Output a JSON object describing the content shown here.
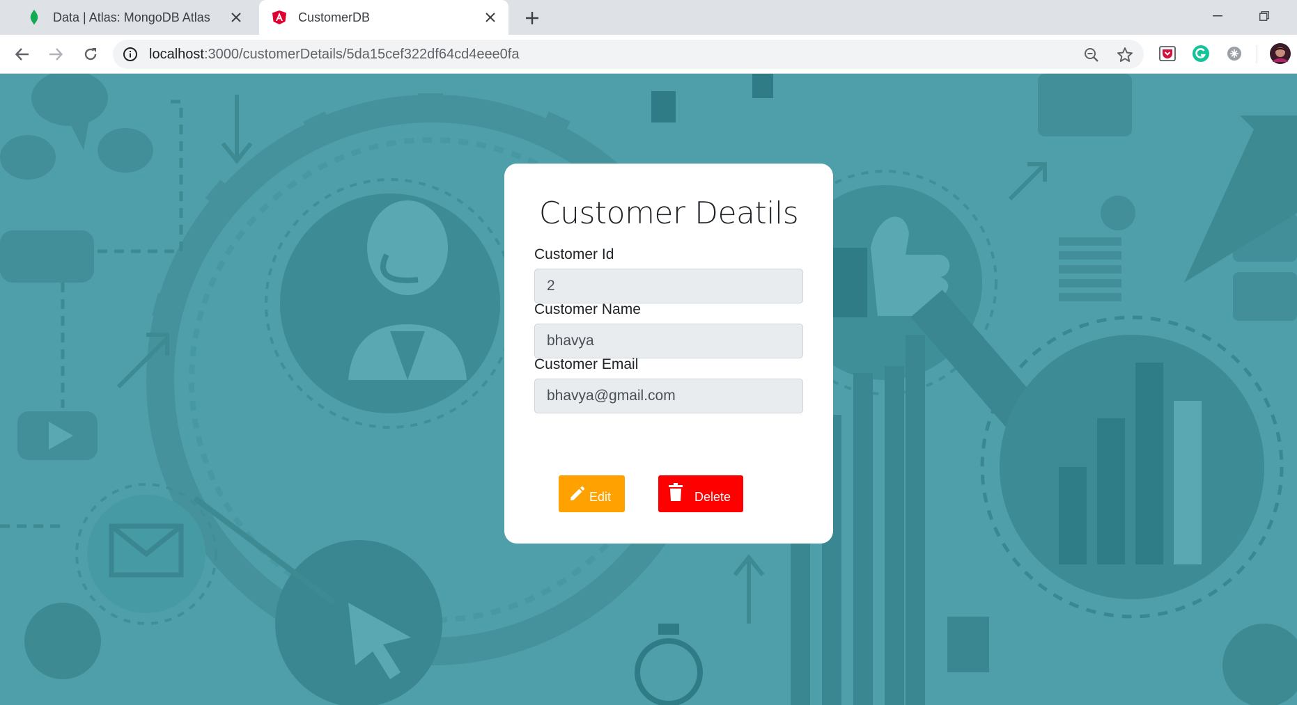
{
  "browser": {
    "tabs": [
      {
        "title": "Data | Atlas: MongoDB Atlas",
        "favicon": "mongodb-leaf-icon",
        "active": false
      },
      {
        "title": "CustomerDB",
        "favicon": "angular-shield-icon",
        "active": true
      }
    ],
    "url_host": "localhost",
    "url_path": ":3000/customerDetails/5da15cef322df64cd4eee0fa"
  },
  "card": {
    "title": "Customer Deatils",
    "fields": [
      {
        "label": "Customer Id",
        "value": "2"
      },
      {
        "label": "Customer Name",
        "value": "bhavya"
      },
      {
        "label": "Customer Email",
        "value": "bhavya@gmail.com"
      }
    ],
    "edit_label": "Edit",
    "delete_label": "Delete"
  },
  "colors": {
    "background": "#4e9fa9",
    "edit_button": "#ffa100",
    "delete_button": "#ff0000"
  }
}
